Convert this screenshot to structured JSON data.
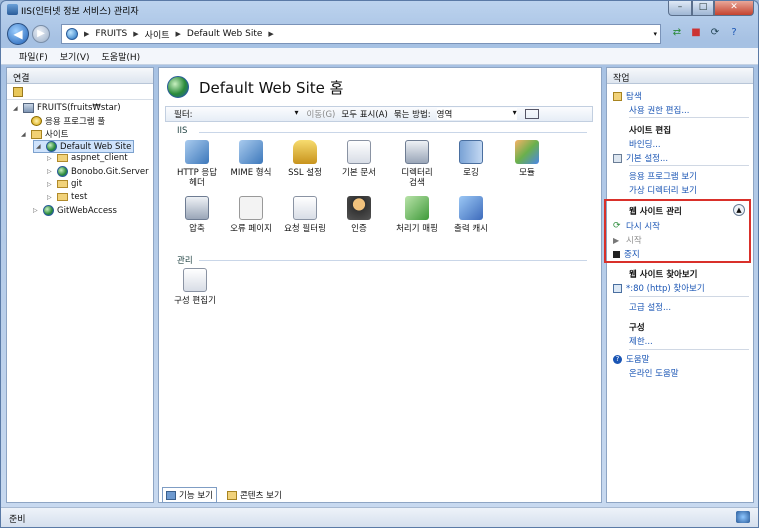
{
  "window": {
    "title": "IIS(인터넷 정보 서비스) 관리자",
    "min": "–",
    "max": "□",
    "close": "✕"
  },
  "nav": {
    "back": "◀",
    "forward": "▶",
    "breadcrumb": [
      "FRUITS",
      "사이트",
      "Default Web Site"
    ],
    "separator": "▶",
    "dropdown": "▾",
    "icons": [
      "network-icon",
      "stop-icon",
      "refresh-icon",
      "help-icon"
    ]
  },
  "menu": [
    "파일(F)",
    "보기(V)",
    "도움말(H)"
  ],
  "connections": {
    "header": "연결",
    "tree": [
      {
        "label": "FRUITS(fruits₩star)",
        "icon": "server"
      },
      {
        "label": "응용 프로그램 풀",
        "icon": "pool"
      },
      {
        "label": "사이트",
        "icon": "sites"
      },
      {
        "label": "Default Web Site",
        "icon": "globe",
        "selected": true
      },
      {
        "label": "aspnet_client",
        "icon": "folder"
      },
      {
        "label": "Bonobo.Git.Server",
        "icon": "app"
      },
      {
        "label": "git",
        "icon": "folder"
      },
      {
        "label": "test",
        "icon": "folder"
      },
      {
        "label": "GitWebAccess",
        "icon": "globe"
      }
    ]
  },
  "center": {
    "title": "Default Web Site 홈",
    "filter": {
      "label": "필터:",
      "go": "이동(G)",
      "show_all": "모두 표시(A)",
      "group_by": "묶는 방법:",
      "group_value": "영역"
    },
    "sections": [
      {
        "label": "IIS",
        "features": [
          "HTTP 응답\n헤더",
          "MIME 형식",
          "SSL 설정",
          "기본 문서",
          "디렉터리\n검색",
          "로깅",
          "모듈",
          "압축",
          "오류 페이지",
          "요청 필터링",
          "인증",
          "처리기 매핑",
          "출력 캐시"
        ]
      },
      {
        "label": "관리",
        "features": [
          "구성 편집기"
        ]
      }
    ],
    "tabs": [
      "기능 보기",
      "콘텐츠 보기"
    ]
  },
  "actions": {
    "header": "작업",
    "explore": "탐색",
    "edit_perms": "사용 권한 편집...",
    "site_edit_header": "사이트 편집",
    "bindings": "바인딩...",
    "basic_settings": "기본 설정...",
    "view_apps": "응용 프로그램 보기",
    "view_vdirs": "가상 디렉터리 보기",
    "manage_header": "웹 사이트 관리",
    "restart": "다시 시작",
    "start": "시작",
    "stop": "중지",
    "browse_header": "웹 사이트 찾아보기",
    "browse_80": "*:80 (http) 찾아보기",
    "advanced": "고급 설정...",
    "config_header": "구성",
    "limits": "제한...",
    "help": "도움말",
    "online_help": "온라인 도움말"
  },
  "status": {
    "text": "준비"
  }
}
